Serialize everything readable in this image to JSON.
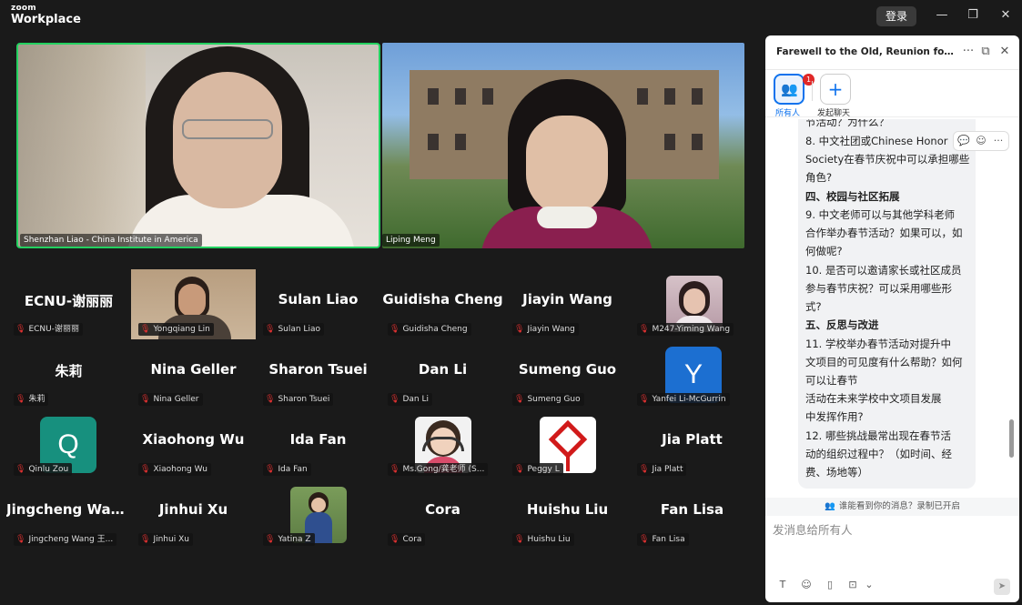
{
  "app": {
    "logo_line1": "zoom",
    "logo_line2": "Workplace",
    "login_label": "登录",
    "minimize_icon": "—",
    "restore_icon": "❐",
    "close_icon": "✕"
  },
  "videos": {
    "main_label": "Shenzhan Liao - China Institute in America",
    "second_label": "Liping Meng"
  },
  "gallery": [
    {
      "name": "ECNU-谢丽丽",
      "label": "ECNU-谢丽丽"
    },
    {
      "name": "",
      "label": "Yongqiang Lin"
    },
    {
      "name": "Sulan Liao",
      "label": "Sulan Liao"
    },
    {
      "name": "Guidisha Cheng",
      "label": "Guidisha Cheng"
    },
    {
      "name": "Jiayin Wang",
      "label": "Jiayin Wang"
    },
    {
      "name": "",
      "label": "M247-Yiming Wang"
    },
    {
      "name": "朱莉",
      "label": "朱莉"
    },
    {
      "name": "Nina Geller",
      "label": "Nina Geller"
    },
    {
      "name": "Sharon Tsuei",
      "label": "Sharon Tsuei"
    },
    {
      "name": "Dan Li",
      "label": "Dan Li"
    },
    {
      "name": "Sumeng Guo",
      "label": "Sumeng Guo"
    },
    {
      "name": "",
      "label": "Yanfei Li-McGurrin",
      "letter": "Y"
    },
    {
      "name": "",
      "label": "Qinlu Zou",
      "letter": "Q"
    },
    {
      "name": "Xiaohong Wu",
      "label": "Xiaohong Wu"
    },
    {
      "name": "Ida Fan",
      "label": "Ida Fan"
    },
    {
      "name": "",
      "label": "Ms.Gong/龚老师 (S..."
    },
    {
      "name": "",
      "label": "Peggy L"
    },
    {
      "name": "Jia Platt",
      "label": "Jia Platt"
    },
    {
      "name": "Jingcheng  Wan...",
      "label": "Jingcheng Wang 王..."
    },
    {
      "name": "Jinhui Xu",
      "label": "Jinhui Xu"
    },
    {
      "name": "",
      "label": "Yatina Z"
    },
    {
      "name": "Cora",
      "label": "Cora"
    },
    {
      "name": "Huishu Liu",
      "label": "Huishu Liu"
    },
    {
      "name": "Fan Lisa",
      "label": "Fan Lisa"
    }
  ],
  "chat": {
    "title": "Farewell to the Old, Reunion for the Ne...",
    "more_icon": "···",
    "popout_icon": "⧉",
    "close_icon": "✕",
    "tab_all_label": "所有人",
    "tab_all_badge": "1",
    "tab_new_label": "发起聊天",
    "tab_new_icon": "+",
    "message_lines": [
      "节活动？为什么？",
      "8.  中文社团或Chinese Honor",
      "Society在春节庆祝中可以承担哪些",
      "角色?",
      "  四、校园与社区拓展",
      "   9. 中文老师可以与其他学科老师",
      "合作举办春节活动？如果可以，如",
      "何做呢?",
      "10. 是否可以邀请家长或社区成员",
      "参与春节庆祝？可以采用哪些形",
      "式?",
      "  五、反思与改进",
      "   11. 学校举办春节活动对提升中",
      "文项目的可见度有什么帮助？如何",
      "可以让春节",
      "       活动在未来学校中文项目发展",
      "中发挥作用?",
      "   12. 哪些挑战最常出现在春节活",
      "动的组织过程中？（如时间、经",
      "费、场地等）"
    ],
    "notice": "谁能看到你的消息？录制已开启",
    "input_placeholder": "发消息给所有人",
    "colors": {
      "accent": "#0e72ed",
      "speaker_border": "#23d160",
      "badge": "#e02828"
    }
  }
}
